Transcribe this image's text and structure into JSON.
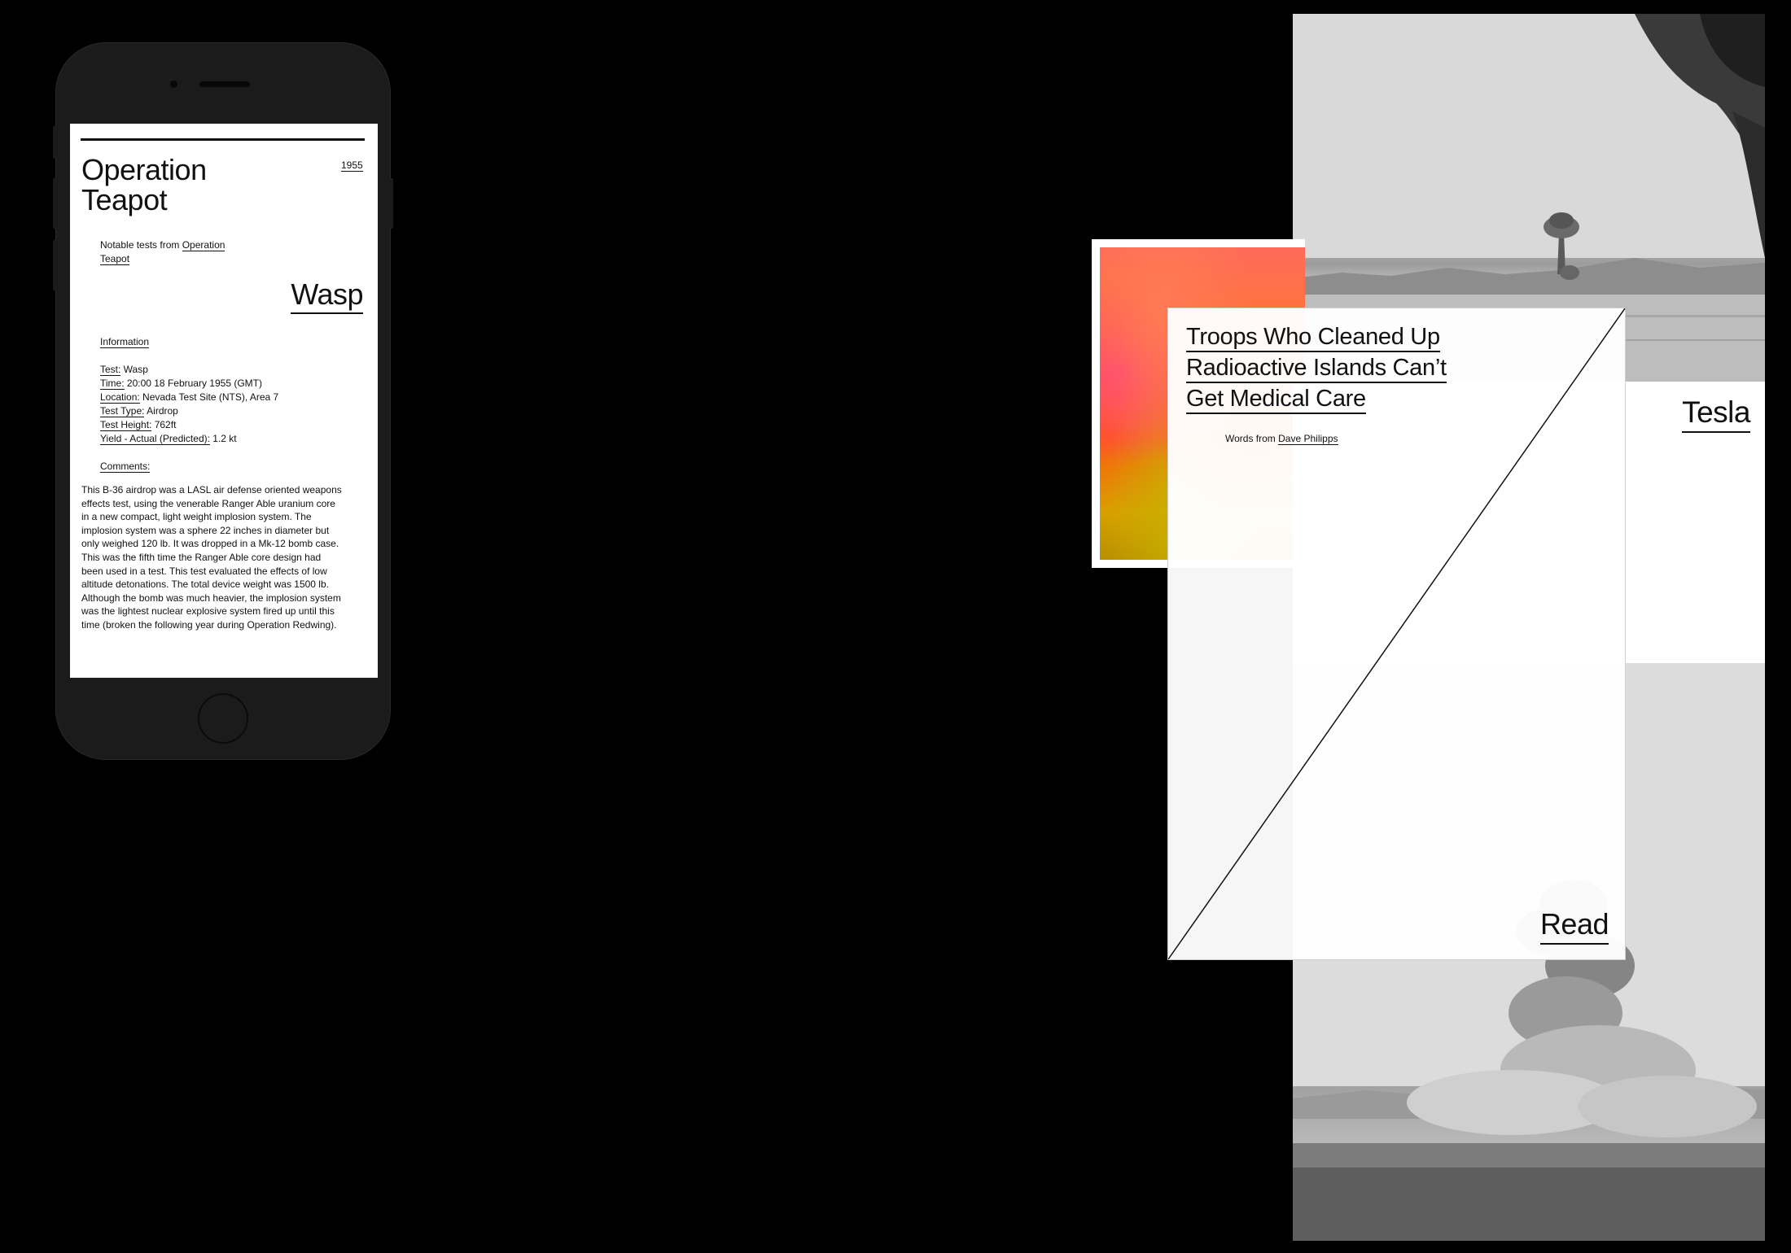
{
  "phone": {
    "title_line1": "Operation",
    "title_line2": "Teapot",
    "year": "1955",
    "notable_prefix": "Notable tests from ",
    "notable_link_1": "Operation",
    "notable_link_2": "Teapot",
    "test_name": "Wasp",
    "information_label": "Information",
    "fields": [
      {
        "label": "Test:",
        "value": " Wasp"
      },
      {
        "label": "Time:",
        "value": " 20:00 18 February 1955 (GMT)"
      },
      {
        "label": "Location:",
        "value": " Nevada Test Site (NTS), Area 7"
      },
      {
        "label": "Test Type:",
        "value": " Airdrop"
      },
      {
        "label": "Test Height:",
        "value": " 762ft"
      },
      {
        "label": "Yield - Actual (Predicted):",
        "value": " 1.2 kt"
      }
    ],
    "comments_label": "Comments:",
    "comments_text": "This B-36 airdrop was a LASL air defense oriented weapons effects test, using the venerable Ranger Able uranium core in a new compact, light weight implosion system. The implosion system was a sphere 22 inches in diameter but only weighed 120 lb. It was dropped in a Mk-12 bomb case. This was the fifth time the Ranger Able core design had been used in a test. This test evaluated the effects of low altitude detonations. The total device weight was 1500 lb. Although the bomb was much heavier, the implosion system was the lightest nuclear explosive system fired up until this time (broken the following year during Operation Redwing)."
  },
  "tesla_card": {
    "name": "Tesla"
  },
  "article": {
    "headline_line1": "Troops Who Cleaned Up",
    "headline_line2": "Radioactive Islands Can’t",
    "headline_line3": "Get Medical Care",
    "words_prefix": "Words from ",
    "author": "Dave Philipps",
    "read_label": "Read"
  },
  "colors": {
    "background": "#000000",
    "card": "#ffffff",
    "ink": "#111111"
  }
}
